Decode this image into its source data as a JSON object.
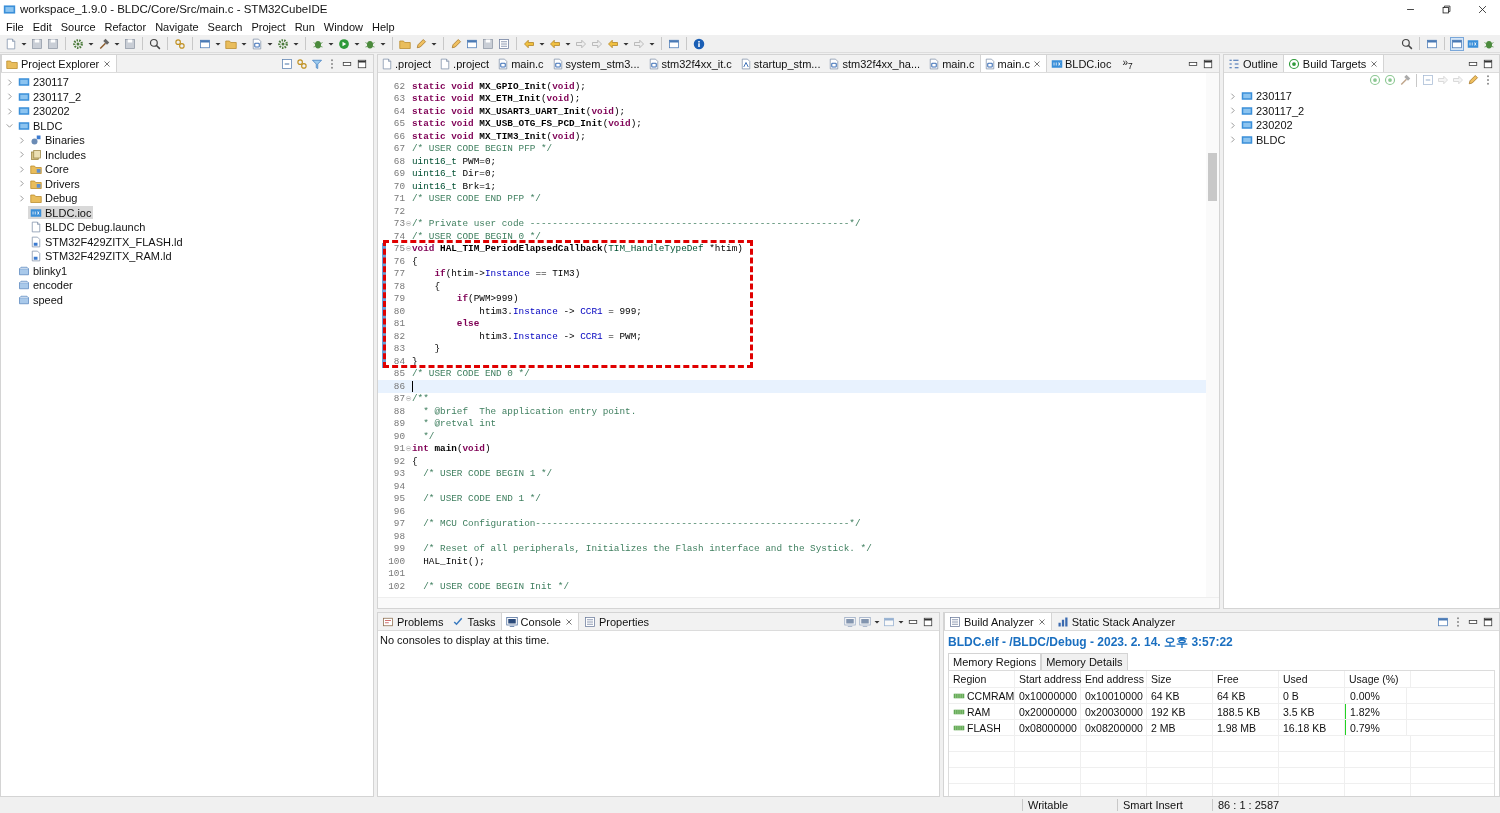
{
  "window": {
    "title": "workspace_1.9.0 - BLDC/Core/Src/main.c - STM32CubeIDE"
  },
  "menu": [
    "File",
    "Edit",
    "Source",
    "Refactor",
    "Navigate",
    "Search",
    "Project",
    "Run",
    "Window",
    "Help"
  ],
  "project_explorer": {
    "title": "Project Explorer",
    "items": [
      {
        "label": "230117",
        "kind": "project",
        "expanded": false,
        "selected": false
      },
      {
        "label": "230117_2",
        "kind": "project",
        "expanded": false,
        "selected": false
      },
      {
        "label": "230202",
        "kind": "project",
        "expanded": false,
        "selected": false
      },
      {
        "label": "BLDC",
        "kind": "project",
        "expanded": true,
        "selected": false,
        "children": [
          {
            "label": "Binaries",
            "kind": "binaries",
            "expanded": false,
            "selected": false
          },
          {
            "label": "Includes",
            "kind": "includes",
            "expanded": false,
            "selected": false
          },
          {
            "label": "Core",
            "kind": "source-folder",
            "expanded": false,
            "selected": false
          },
          {
            "label": "Drivers",
            "kind": "source-folder",
            "expanded": false,
            "selected": false
          },
          {
            "label": "Debug",
            "kind": "folder",
            "expanded": false,
            "selected": false
          },
          {
            "label": "BLDC.ioc",
            "kind": "mx",
            "selected": true
          },
          {
            "label": "BLDC Debug.launch",
            "kind": "document",
            "selected": false
          },
          {
            "label": "STM32F429ZITX_FLASH.ld",
            "kind": "linker",
            "selected": false
          },
          {
            "label": "STM32F429ZITX_RAM.ld",
            "kind": "linker",
            "selected": false
          }
        ]
      },
      {
        "label": "blinky1",
        "kind": "closed-project",
        "selected": false
      },
      {
        "label": "encoder",
        "kind": "closed-project",
        "selected": false
      },
      {
        "label": "speed",
        "kind": "closed-project",
        "selected": false
      }
    ]
  },
  "editor": {
    "tabs": [
      {
        "label": ".project",
        "kind": "document",
        "selected": false
      },
      {
        "label": ".project",
        "kind": "document",
        "selected": false
      },
      {
        "label": "main.c",
        "kind": "source",
        "selected": false
      },
      {
        "label": "system_stm3...",
        "kind": "source",
        "selected": false
      },
      {
        "label": "stm32f4xx_it.c",
        "kind": "source",
        "selected": false
      },
      {
        "label": "startup_stm...",
        "kind": "asm",
        "selected": false
      },
      {
        "label": "stm32f4xx_ha...",
        "kind": "source",
        "selected": false
      },
      {
        "label": "main.c",
        "kind": "source",
        "selected": false
      },
      {
        "label": "main.c",
        "kind": "source",
        "selected": true
      },
      {
        "label": "BLDC.ioc",
        "kind": "mx",
        "selected": false
      }
    ],
    "overflow": "»$_{7}$",
    "lines": [
      {
        "n": "62",
        "fold": false,
        "changed": false,
        "current": false,
        "tokens": [
          {
            "kind": "kw",
            "text": "static void"
          },
          {
            "kind": "decl",
            "text": " MX_GPIO_Init"
          },
          {
            "kind": "plain",
            "text": "("
          },
          {
            "kind": "kw",
            "text": "void"
          },
          {
            "kind": "plain",
            "text": ");"
          }
        ]
      },
      {
        "n": "63",
        "fold": false,
        "changed": false,
        "current": false,
        "tokens": [
          {
            "kind": "kw",
            "text": "static void"
          },
          {
            "kind": "decl",
            "text": " MX_ETH_Init"
          },
          {
            "kind": "plain",
            "text": "("
          },
          {
            "kind": "kw",
            "text": "void"
          },
          {
            "kind": "plain",
            "text": ");"
          }
        ]
      },
      {
        "n": "64",
        "fold": false,
        "changed": false,
        "current": false,
        "tokens": [
          {
            "kind": "kw",
            "text": "static void"
          },
          {
            "kind": "decl",
            "text": " MX_USART3_UART_Init"
          },
          {
            "kind": "plain",
            "text": "("
          },
          {
            "kind": "kw",
            "text": "void"
          },
          {
            "kind": "plain",
            "text": ");"
          }
        ]
      },
      {
        "n": "65",
        "fold": false,
        "changed": false,
        "current": false,
        "tokens": [
          {
            "kind": "kw",
            "text": "static void"
          },
          {
            "kind": "decl",
            "text": " MX_USB_OTG_FS_PCD_Init"
          },
          {
            "kind": "plain",
            "text": "("
          },
          {
            "kind": "kw",
            "text": "void"
          },
          {
            "kind": "plain",
            "text": ");"
          }
        ]
      },
      {
        "n": "66",
        "fold": false,
        "changed": false,
        "current": false,
        "tokens": [
          {
            "kind": "kw",
            "text": "static void"
          },
          {
            "kind": "decl",
            "text": " MX_TIM3_Init"
          },
          {
            "kind": "plain",
            "text": "("
          },
          {
            "kind": "kw",
            "text": "void"
          },
          {
            "kind": "plain",
            "text": ");"
          }
        ]
      },
      {
        "n": "67",
        "fold": false,
        "changed": false,
        "current": false,
        "tokens": [
          {
            "kind": "comment",
            "text": "/* USER CODE BEGIN PFP */"
          }
        ]
      },
      {
        "n": "68",
        "fold": false,
        "changed": false,
        "current": false,
        "tokens": [
          {
            "kind": "type",
            "text": "uint16_t"
          },
          {
            "kind": "plain",
            "text": " PWM=0;"
          }
        ]
      },
      {
        "n": "69",
        "fold": false,
        "changed": false,
        "current": false,
        "tokens": [
          {
            "kind": "type",
            "text": "uint16_t"
          },
          {
            "kind": "plain",
            "text": " Dir=0;"
          }
        ]
      },
      {
        "n": "70",
        "fold": false,
        "changed": false,
        "current": false,
        "tokens": [
          {
            "kind": "type",
            "text": "uint16_t"
          },
          {
            "kind": "plain",
            "text": " Brk=1;"
          }
        ]
      },
      {
        "n": "71",
        "fold": false,
        "changed": false,
        "current": false,
        "tokens": [
          {
            "kind": "comment",
            "text": "/* USER CODE END PFP */"
          }
        ]
      },
      {
        "n": "72",
        "fold": false,
        "changed": false,
        "current": false
      },
      {
        "n": "73",
        "fold": true,
        "changed": false,
        "current": false,
        "tokens": [
          {
            "kind": "comment",
            "text": "/* Private user code ---------------------------------------------------------*/"
          }
        ]
      },
      {
        "n": "74",
        "fold": false,
        "changed": false,
        "current": false,
        "tokens": [
          {
            "kind": "comment",
            "text": "/* USER CODE BEGIN 0 */"
          }
        ]
      },
      {
        "n": "75",
        "fold": true,
        "changed": true,
        "current": false,
        "tokens": [
          {
            "kind": "kw",
            "text": "void"
          },
          {
            "kind": "decl",
            "text": " HAL_TIM_PeriodElapsedCallback"
          },
          {
            "kind": "plain",
            "text": "("
          },
          {
            "kind": "type",
            "text": "TIM_HandleTypeDef"
          },
          {
            "kind": "plain",
            "text": " *htim)"
          }
        ]
      },
      {
        "n": "76",
        "fold": false,
        "changed": true,
        "current": false,
        "tokens": [
          {
            "kind": "plain",
            "text": "{"
          }
        ]
      },
      {
        "n": "77",
        "fold": false,
        "changed": true,
        "current": false,
        "tokens": [
          {
            "kind": "kw",
            "text": "    if"
          },
          {
            "kind": "plain",
            "text": "(htim->"
          },
          {
            "kind": "field",
            "text": "Instance"
          },
          {
            "kind": "plain",
            "text": " == TIM3)"
          }
        ]
      },
      {
        "n": "78",
        "fold": false,
        "changed": true,
        "current": false,
        "tokens": [
          {
            "kind": "plain",
            "text": "    {"
          }
        ]
      },
      {
        "n": "79",
        "fold": false,
        "changed": true,
        "current": false,
        "tokens": [
          {
            "kind": "kw",
            "text": "        if"
          },
          {
            "kind": "plain",
            "text": "(PWM>999)"
          }
        ]
      },
      {
        "n": "80",
        "fold": false,
        "changed": true,
        "current": false,
        "tokens": [
          {
            "kind": "plain",
            "text": "            htim3."
          },
          {
            "kind": "field",
            "text": "Instance"
          },
          {
            "kind": "plain",
            "text": " -> "
          },
          {
            "kind": "field",
            "text": "CCR1"
          },
          {
            "kind": "plain",
            "text": " = 999;"
          }
        ]
      },
      {
        "n": "81",
        "fold": false,
        "changed": true,
        "current": false,
        "tokens": [
          {
            "kind": "kw",
            "text": "        else"
          }
        ]
      },
      {
        "n": "82",
        "fold": false,
        "changed": true,
        "current": false,
        "tokens": [
          {
            "kind": "plain",
            "text": "            htim3."
          },
          {
            "kind": "field",
            "text": "Instance"
          },
          {
            "kind": "plain",
            "text": " -> "
          },
          {
            "kind": "field",
            "text": "CCR1"
          },
          {
            "kind": "plain",
            "text": " = PWM;"
          }
        ]
      },
      {
        "n": "83",
        "fold": false,
        "changed": true,
        "current": false,
        "tokens": [
          {
            "kind": "plain",
            "text": "    }"
          }
        ]
      },
      {
        "n": "84",
        "fold": false,
        "changed": true,
        "current": false,
        "tokens": [
          {
            "kind": "plain",
            "text": "}"
          }
        ]
      },
      {
        "n": "85",
        "fold": false,
        "changed": false,
        "current": false,
        "tokens": [
          {
            "kind": "comment",
            "text": "/* USER CODE END 0 */"
          }
        ]
      },
      {
        "n": "86",
        "fold": false,
        "changed": false,
        "current": true
      },
      {
        "n": "87",
        "fold": true,
        "changed": false,
        "current": false,
        "tokens": [
          {
            "kind": "comment",
            "text": "/**"
          }
        ]
      },
      {
        "n": "88",
        "fold": false,
        "changed": false,
        "current": false,
        "tokens": [
          {
            "kind": "comment",
            "text": "  * @brief  The application entry point."
          }
        ]
      },
      {
        "n": "89",
        "fold": false,
        "changed": false,
        "current": false,
        "tokens": [
          {
            "kind": "comment",
            "text": "  * @retval int"
          }
        ]
      },
      {
        "n": "90",
        "fold": false,
        "changed": false,
        "current": false,
        "tokens": [
          {
            "kind": "comment",
            "text": "  */"
          }
        ]
      },
      {
        "n": "91",
        "fold": true,
        "changed": false,
        "current": false,
        "tokens": [
          {
            "kind": "kw",
            "text": "int"
          },
          {
            "kind": "decl",
            "text": " main"
          },
          {
            "kind": "plain",
            "text": "("
          },
          {
            "kind": "kw",
            "text": "void"
          },
          {
            "kind": "plain",
            "text": ")"
          }
        ]
      },
      {
        "n": "92",
        "fold": false,
        "changed": false,
        "current": false,
        "tokens": [
          {
            "kind": "plain",
            "text": "{"
          }
        ]
      },
      {
        "n": "93",
        "fold": false,
        "changed": false,
        "current": false,
        "tokens": [
          {
            "kind": "comment",
            "text": "  /* USER CODE BEGIN 1 */"
          }
        ]
      },
      {
        "n": "94",
        "fold": false,
        "changed": false,
        "current": false
      },
      {
        "n": "95",
        "fold": false,
        "changed": false,
        "current": false,
        "tokens": [
          {
            "kind": "comment",
            "text": "  /* USER CODE END 1 */"
          }
        ]
      },
      {
        "n": "96",
        "fold": false,
        "changed": false,
        "current": false
      },
      {
        "n": "97",
        "fold": false,
        "changed": false,
        "current": false,
        "tokens": [
          {
            "kind": "comment",
            "text": "  /* MCU Configuration--------------------------------------------------------*/"
          }
        ]
      },
      {
        "n": "98",
        "fold": false,
        "changed": false,
        "current": false
      },
      {
        "n": "99",
        "fold": false,
        "changed": false,
        "current": false,
        "tokens": [
          {
            "kind": "comment",
            "text": "  /* Reset of all peripherals, Initializes the Flash interface and the Systick. */"
          }
        ]
      },
      {
        "n": "100",
        "fold": false,
        "changed": false,
        "current": false,
        "tokens": [
          {
            "kind": "plain",
            "text": "  HAL_Init();"
          }
        ]
      },
      {
        "n": "101",
        "fold": false,
        "changed": false,
        "current": false
      },
      {
        "n": "102",
        "fold": false,
        "changed": false,
        "current": false,
        "tokens": [
          {
            "kind": "comment",
            "text": "  /* USER CODE BEGIN Init */"
          }
        ]
      }
    ]
  },
  "side_panel": {
    "tabs": [
      {
        "label": "Outline",
        "selected": false
      },
      {
        "label": "Build Targets",
        "selected": true
      }
    ],
    "items": [
      {
        "label": "230117",
        "expanded": false
      },
      {
        "label": "230117_2",
        "expanded": false
      },
      {
        "label": "230202",
        "expanded": false
      },
      {
        "label": "BLDC",
        "expanded": false
      }
    ]
  },
  "console_panel": {
    "tabs": [
      {
        "label": "Problems",
        "selected": false
      },
      {
        "label": "Tasks",
        "selected": false
      },
      {
        "label": "Console",
        "selected": true
      },
      {
        "label": "Properties",
        "selected": false
      }
    ],
    "message": "No consoles to display at this time."
  },
  "analyzer_panel": {
    "tabs": [
      {
        "label": "Build Analyzer",
        "selected": true
      },
      {
        "label": "Static Stack Analyzer",
        "selected": false
      }
    ],
    "heading": "BLDC.elf - /BLDC/Debug - 2023. 2. 14. 오후 3:57:22",
    "subtabs": [
      {
        "label": "Memory Regions",
        "selected": true
      },
      {
        "label": "Memory Details",
        "selected": false
      }
    ],
    "columns": [
      "Region",
      "Start address",
      "End address",
      "Size",
      "Free",
      "Used",
      "Usage (%)"
    ],
    "rows": [
      {
        "cells": [
          "CCMRAM",
          "0x10000000",
          "0x10010000",
          "64 KB",
          "64 KB",
          "0 B",
          "0.00%"
        ]
      },
      {
        "cells": [
          "RAM",
          "0x20000000",
          "0x20030000",
          "192 KB",
          "188.5 KB",
          "3.5 KB",
          "1.82%"
        ],
        "level": 0.0182
      },
      {
        "cells": [
          "FLASH",
          "0x08000000",
          "0x08200000",
          "2 MB",
          "1.98 MB",
          "16.18 KB",
          "0.79%"
        ],
        "level": 0.0079
      }
    ]
  },
  "status_bar": [
    "Writable",
    "Smart Insert",
    "86 : 1 : 2587"
  ]
}
